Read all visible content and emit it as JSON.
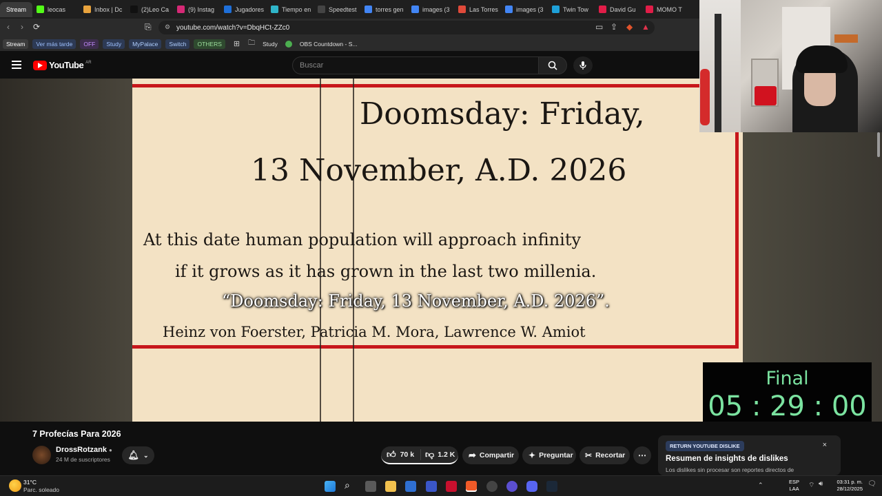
{
  "browser": {
    "tabs": [
      {
        "label": "Stream",
        "active": true,
        "color": "#3a3a3a"
      },
      {
        "label": "leocas",
        "color": "#53fc18"
      },
      {
        "label": "Inbox | Dc",
        "color": "#e8a33d"
      },
      {
        "label": "(2)Leo Ca",
        "color": "#111111"
      },
      {
        "label": "(9) Instag",
        "color": "#d62976"
      },
      {
        "label": "Jugadores",
        "color": "#1e6fd9"
      },
      {
        "label": "Tiempo en",
        "color": "#2fb5c9"
      },
      {
        "label": "Speedtest",
        "color": "#444444"
      },
      {
        "label": "torres gen",
        "color": "#4285f4"
      },
      {
        "label": "images (3",
        "color": "#4285f4"
      },
      {
        "label": "Las Torres",
        "color": "#e04a3a"
      },
      {
        "label": "images (3",
        "color": "#4285f4"
      },
      {
        "label": "Twin Tow",
        "color": "#1ea0d8"
      },
      {
        "label": "David Gu",
        "color": "#e11d48"
      },
      {
        "label": "MOMO T",
        "color": "#e11d48"
      }
    ],
    "url": "youtube.com/watch?v=DbqHCt-ZZc0",
    "bookmarks": [
      {
        "label": "Stream",
        "bg": "#3c3c3c",
        "fg": "#ffffff"
      },
      {
        "label": "Ver más tarde",
        "bg": "#2d3a55",
        "fg": "#9ec1ff"
      },
      {
        "label": "OFF",
        "bg": "#3d2d4d",
        "fg": "#c58cff"
      },
      {
        "label": "Study",
        "bg": "#2d3a55",
        "fg": "#9ec1ff"
      },
      {
        "label": "MyPalace",
        "bg": "#2d3a55",
        "fg": "#b0cfff"
      },
      {
        "label": "Switch",
        "bg": "#2d3a55",
        "fg": "#b0cfff"
      },
      {
        "label": "OTHERS",
        "bg": "#2f4a2f",
        "fg": "#9ee09e"
      },
      {
        "label": "Study",
        "bg": "transparent",
        "fg": "#e0e0e0"
      },
      {
        "label": "OBS Countdown - S...",
        "bg": "transparent",
        "fg": "#e0e0e0"
      }
    ]
  },
  "youtube": {
    "logo_text": "YouTube",
    "region": "AR",
    "search_placeholder": "Buscar"
  },
  "video": {
    "paper_title_1": "Doomsday: Friday,",
    "paper_title_2": "13 November, A.D. 2026",
    "paper_body_1": "At this date human population will approach infinity",
    "paper_body_2": "if it grows as it has grown in the last two millenia.",
    "paper_authors": "Heinz von Foerster, Patricia M. Mora, Lawrence W. Amiot",
    "subtitle": "“Doomsday: Friday, 13 November, A.D. 2026”.",
    "timer_label": "Final",
    "timer_value": "05 : 29 : 00"
  },
  "meta": {
    "title": "7 Profecías Para 2026",
    "channel": "DrossRotzank",
    "subscribers": "24 M de suscriptores",
    "likes": "70 k",
    "dislikes": "1.2 K",
    "share": "Compartir",
    "ask": "Preguntar",
    "clip": "Recortar"
  },
  "popup": {
    "badge": "RETURN YOUTUBE DISLIKE",
    "title": "Resumen de insights de dislikes",
    "text": "Los dislikes sin procesar son reportes directos de"
  },
  "taskbar": {
    "temp": "31°C",
    "weather": "Parc. soleado",
    "lang1": "ESP",
    "lang2": "LAA",
    "time": "03:31 p. m.",
    "date": "28/12/2025"
  }
}
